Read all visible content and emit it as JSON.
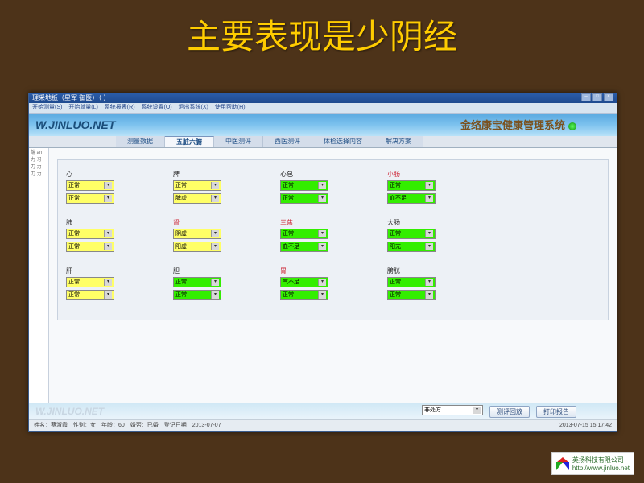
{
  "slide": {
    "title": "主要表现是少阴经"
  },
  "window": {
    "title": "理采地板（星军 御医）（ ）",
    "menu": [
      "开始测量(S)",
      "开始就量(L)",
      "系统报表(R)",
      "系统设置(O)",
      "退出系统(X)",
      "使用帮助(H)"
    ]
  },
  "banner": {
    "logo": "W.JINLUO.NET",
    "system_name": "金络康宝健康管理系统"
  },
  "tabs": [
    "测量数据",
    "五脏六腑",
    "中医测评",
    "西医测评",
    "体检选择内容",
    "解决方案"
  ],
  "active_tab": 1,
  "sidebar_text": "端\n\nan\n\n力\n习\n刀\n力\n刀\n力",
  "organs": [
    {
      "row": 0,
      "col": 0,
      "label": "心",
      "warn": false,
      "c1": {
        "val": "正常",
        "color": "yellow"
      },
      "c2": {
        "val": "正常",
        "color": "yellow"
      }
    },
    {
      "row": 0,
      "col": 1,
      "label": "脾",
      "warn": false,
      "c1": {
        "val": "正常",
        "color": "yellow"
      },
      "c2": {
        "val": "脾虚",
        "color": "yellow"
      }
    },
    {
      "row": 0,
      "col": 2,
      "label": "心包",
      "warn": false,
      "c1": {
        "val": "正常",
        "color": "green"
      },
      "c2": {
        "val": "正常",
        "color": "green"
      }
    },
    {
      "row": 0,
      "col": 3,
      "label": "小肠",
      "warn": true,
      "c1": {
        "val": "正常",
        "color": "green"
      },
      "c2": {
        "val": "血不足",
        "color": "green"
      }
    },
    {
      "row": 1,
      "col": 0,
      "label": "肺",
      "warn": false,
      "c1": {
        "val": "正常",
        "color": "yellow"
      },
      "c2": {
        "val": "正常",
        "color": "yellow"
      }
    },
    {
      "row": 1,
      "col": 1,
      "label": "肾",
      "warn": true,
      "c1": {
        "val": "阴虚",
        "color": "yellow"
      },
      "c2": {
        "val": "阳虚",
        "color": "yellow"
      }
    },
    {
      "row": 1,
      "col": 2,
      "label": "三焦",
      "warn": true,
      "c1": {
        "val": "正常",
        "color": "green"
      },
      "c2": {
        "val": "血不足",
        "color": "green"
      }
    },
    {
      "row": 1,
      "col": 3,
      "label": "大肠",
      "warn": false,
      "c1": {
        "val": "正常",
        "color": "green"
      },
      "c2": {
        "val": "阳亢",
        "color": "green"
      }
    },
    {
      "row": 2,
      "col": 0,
      "label": "肝",
      "warn": false,
      "c1": {
        "val": "正常",
        "color": "yellow"
      },
      "c2": {
        "val": "正常",
        "color": "yellow"
      }
    },
    {
      "row": 2,
      "col": 1,
      "label": "胆",
      "warn": false,
      "c1": {
        "val": "正常",
        "color": "green"
      },
      "c2": {
        "val": "正常",
        "color": "green"
      }
    },
    {
      "row": 2,
      "col": 2,
      "label": "胃",
      "warn": true,
      "c1": {
        "val": "气不足",
        "color": "green"
      },
      "c2": {
        "val": "正常",
        "color": "green"
      }
    },
    {
      "row": 2,
      "col": 3,
      "label": "膀胱",
      "warn": false,
      "c1": {
        "val": "正常",
        "color": "green"
      },
      "c2": {
        "val": "正常",
        "color": "green"
      }
    }
  ],
  "bottom": {
    "logo": "W.JINLUO.NET",
    "select_value": "非处方",
    "btn_review": "测评回放",
    "btn_print": "打印报告"
  },
  "status": {
    "left": "姓名：蔡淑霞　性别：女　年龄：60　婚否：已婚　登记日期：2013-07-07",
    "right": "2013-07-15 15:17:42"
  },
  "footer": {
    "company": "英扬科技有限公司",
    "url": "http://www.jinluo.net"
  }
}
